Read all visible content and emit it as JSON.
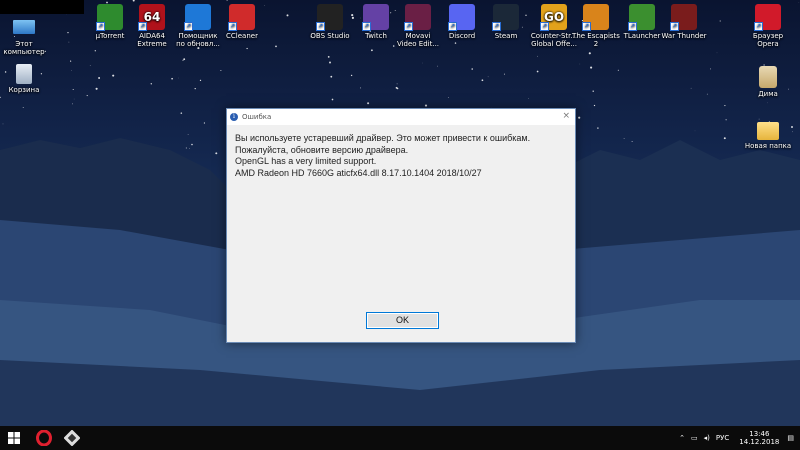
{
  "desktop_icons_left": [
    {
      "label": "Этот\nкомпьютер",
      "icon": "computer-icon"
    },
    {
      "label": "Корзина",
      "icon": "recycle-bin-icon"
    }
  ],
  "desktop_icons_top": [
    {
      "label": "µTorrent",
      "icon": "utorrent-icon",
      "color": "#2e8b2e"
    },
    {
      "label": "AIDA64\nExtreme",
      "icon": "aida64-icon",
      "color": "#b0121b",
      "glyph": "64"
    },
    {
      "label": "Помощник\nпо обновл...",
      "icon": "windows-icon",
      "color": "#1e78d7"
    },
    {
      "label": "CCleaner",
      "icon": "ccleaner-icon",
      "color": "#d02b2b"
    },
    {
      "label": "OBS Studio",
      "icon": "obs-icon",
      "color": "#222222"
    },
    {
      "label": "Twitch",
      "icon": "twitch-icon",
      "color": "#6441a5"
    },
    {
      "label": "Movavi\nVideo Edit...",
      "icon": "movavi-icon",
      "color": "#6a1f45"
    },
    {
      "label": "Discord",
      "icon": "discord-icon",
      "color": "#5865f2"
    },
    {
      "label": "Steam",
      "icon": "steam-icon",
      "color": "#1b2838"
    },
    {
      "label": "Counter-Str...\nGlobal Offe...",
      "icon": "csgo-icon",
      "color": "#e2a21b",
      "glyph": "GO"
    },
    {
      "label": "The Escapists\n2",
      "icon": "escapists-icon",
      "color": "#d9841b"
    },
    {
      "label": "TLauncher",
      "icon": "tlauncher-icon",
      "color": "#3b8f2f"
    },
    {
      "label": "War Thunder",
      "icon": "warthunder-icon",
      "color": "#7a1c1c"
    },
    {
      "label": "Браузер\nOpera",
      "icon": "opera-icon",
      "color": "#d11a2a"
    }
  ],
  "desktop_icons_right": [
    {
      "label": "Дима",
      "icon": "user-folder-icon"
    },
    {
      "label": "Новая папка",
      "icon": "folder-icon"
    }
  ],
  "dialog": {
    "title": "Ошибка",
    "close": "×",
    "lines": [
      "Вы используете устаревший драйвер. Это может привести к ошибкам.",
      "Пожалуйста, обновите версию драйвера.",
      "OpenGL has a very limited support.",
      "AMD Radeon HD 7660G aticfx64.dll 8.17.10.1404 2018/10/27"
    ],
    "ok_label": "OK"
  },
  "taskbar": {
    "tray_lang": "РУС",
    "time": "13:46",
    "date": "14.12.2018"
  }
}
